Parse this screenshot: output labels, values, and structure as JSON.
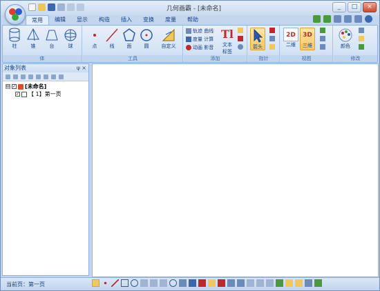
{
  "app": {
    "title": "几何画霸 - [未命名]",
    "tabs": [
      {
        "label": "常用",
        "active": true
      },
      {
        "label": "编辑"
      },
      {
        "label": "显示"
      },
      {
        "label": "构造"
      },
      {
        "label": "插入"
      },
      {
        "label": "变换"
      },
      {
        "label": "度量"
      },
      {
        "label": "帮助"
      }
    ],
    "window_buttons": {
      "minimize": "_",
      "maximize": "□",
      "close": "×"
    }
  },
  "ribbon": {
    "groups": [
      {
        "label": "体",
        "items": [
          "柱",
          "锥",
          "台",
          "球"
        ]
      },
      {
        "label": "工具",
        "items": [
          "点",
          "线",
          "面",
          "圆",
          "自定义"
        ]
      },
      {
        "label": "添加",
        "items": [
          "轨迹 曲线",
          "度量 计算",
          "动画 影音",
          "文本",
          "标签"
        ]
      },
      {
        "label": "指针",
        "items": [
          "箭头"
        ]
      },
      {
        "label": "视图",
        "items": [
          "二维",
          "三维"
        ]
      },
      {
        "label": "修改",
        "items": [
          "颜色"
        ]
      }
    ]
  },
  "panel": {
    "title": "对象列表",
    "pin": "ψ",
    "close": "×",
    "tree": [
      {
        "label": "[未命名]",
        "level": 0,
        "expander": "⊟"
      },
      {
        "label": "【 1】第一页",
        "level": 1,
        "expander": ""
      }
    ]
  },
  "status": {
    "current_page_label": "当前页：第一页"
  },
  "colors": {
    "accent": "#15428b",
    "ribbon_bg": "#d4e3f5",
    "highlight": "#f8c55b"
  }
}
